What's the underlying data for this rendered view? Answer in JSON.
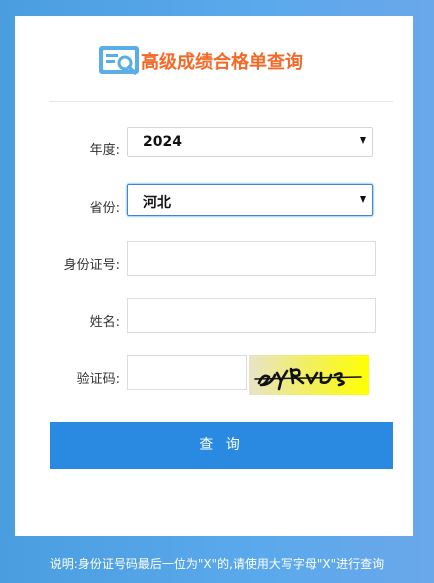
{
  "header": {
    "title": "高级成绩合格单查询",
    "logo_icon": "search-document-icon"
  },
  "form": {
    "year": {
      "label": "年度:",
      "value": "2024"
    },
    "province": {
      "label": "省份:",
      "value": "河北"
    },
    "id_number": {
      "label": "身份证号:",
      "value": ""
    },
    "name": {
      "label": "姓名:",
      "value": ""
    },
    "captcha": {
      "label": "验证码:",
      "value": ""
    },
    "submit_label": "查 询"
  },
  "footer": {
    "note": "说明:身份证号码最后一位为\"X\"的,请使用大写字母\"X\"进行查询"
  },
  "colors": {
    "accent": "#2a8ae2",
    "title": "#f26a28",
    "background": "#5aa9ec"
  }
}
